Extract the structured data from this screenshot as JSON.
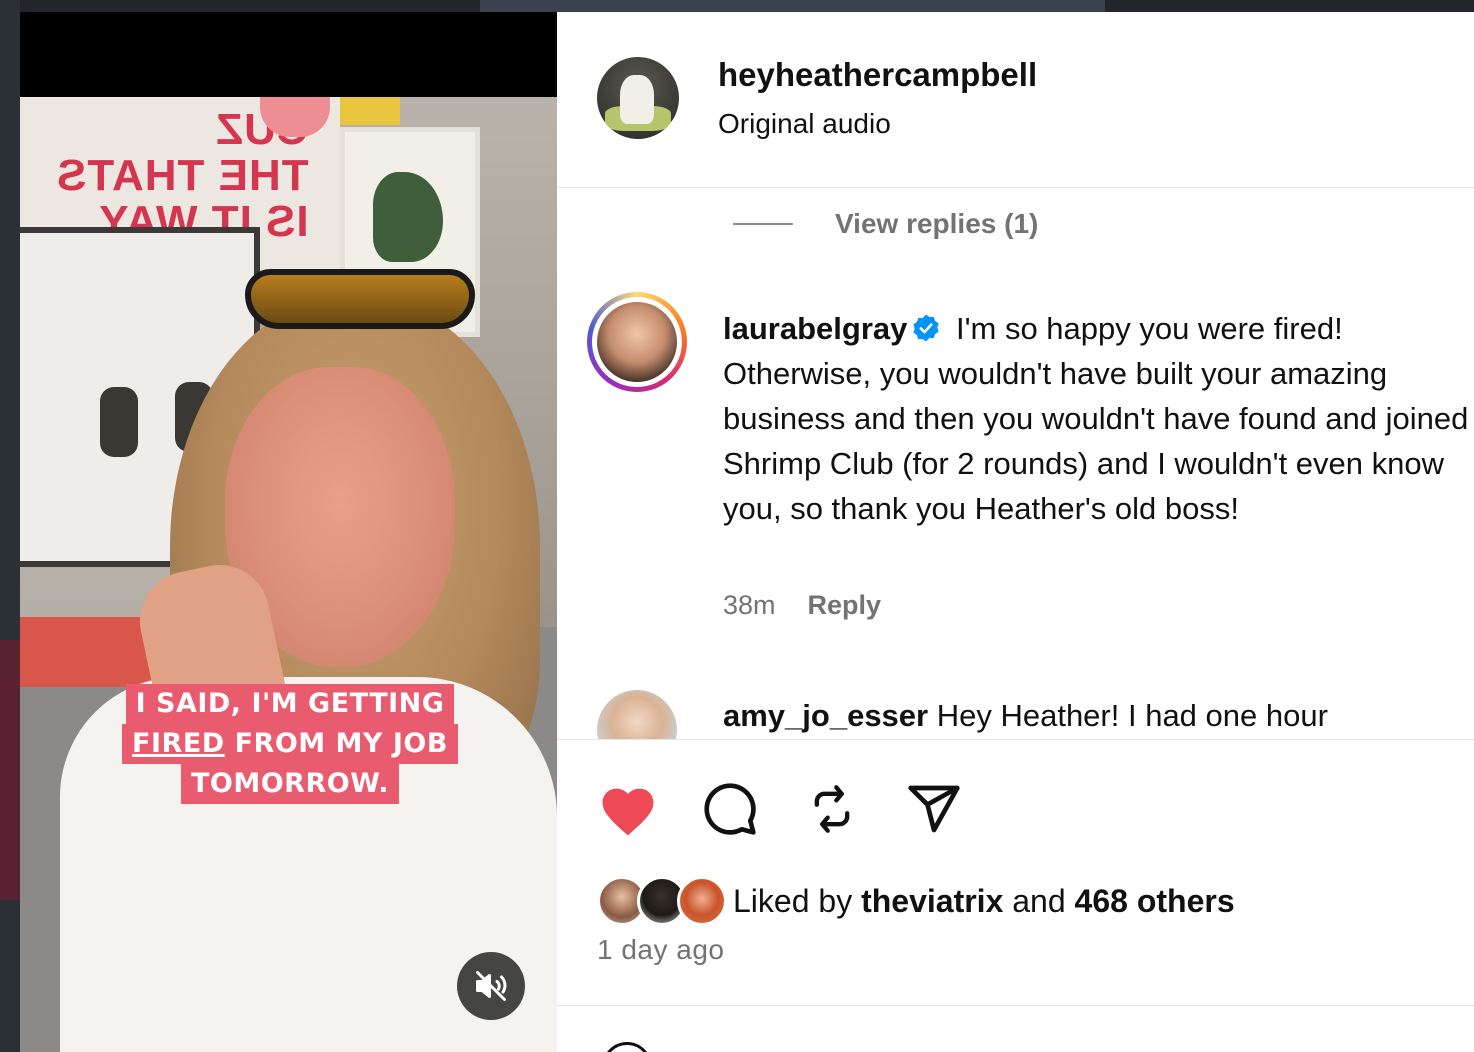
{
  "post": {
    "username": "heyheathercampbell",
    "audio": "Original audio",
    "view_replies": "View replies (1)"
  },
  "video": {
    "caption_line1": "I SAID, I'M GETTING",
    "caption_fired": "FIRED",
    "caption_line2_rest": " FROM MY JOB",
    "caption_line3": "TOMORROW.",
    "poster_text": "CUZ\nTHE THATS\nIS IT WAY"
  },
  "comments": [
    {
      "username": "laurabelgray",
      "verified": true,
      "text": " I'm so happy you were fired! Otherwise, you wouldn't have built your amazing business and then you wouldn't have found and joined Shrimp Club (for 2 rounds) and I wouldn't even know you, so thank you Heather's old boss!",
      "time": "38m",
      "reply_label": "Reply"
    },
    {
      "username": "amy_jo_esser",
      "text": " Hey Heather! I had one hour"
    }
  ],
  "likes": {
    "prefix": "Liked by ",
    "first_user": "theviatrix",
    "middle": " and ",
    "others": "468 others"
  },
  "posted": "1 day ago",
  "colors": {
    "heart": "#ed4956",
    "verified": "#0095f6",
    "caption_bg": "#e95b6f",
    "secondary_text": "#737373"
  },
  "icons": [
    "heart-icon",
    "comment-icon",
    "repost-icon",
    "share-icon",
    "muted-speaker-icon",
    "verified-badge-icon"
  ]
}
